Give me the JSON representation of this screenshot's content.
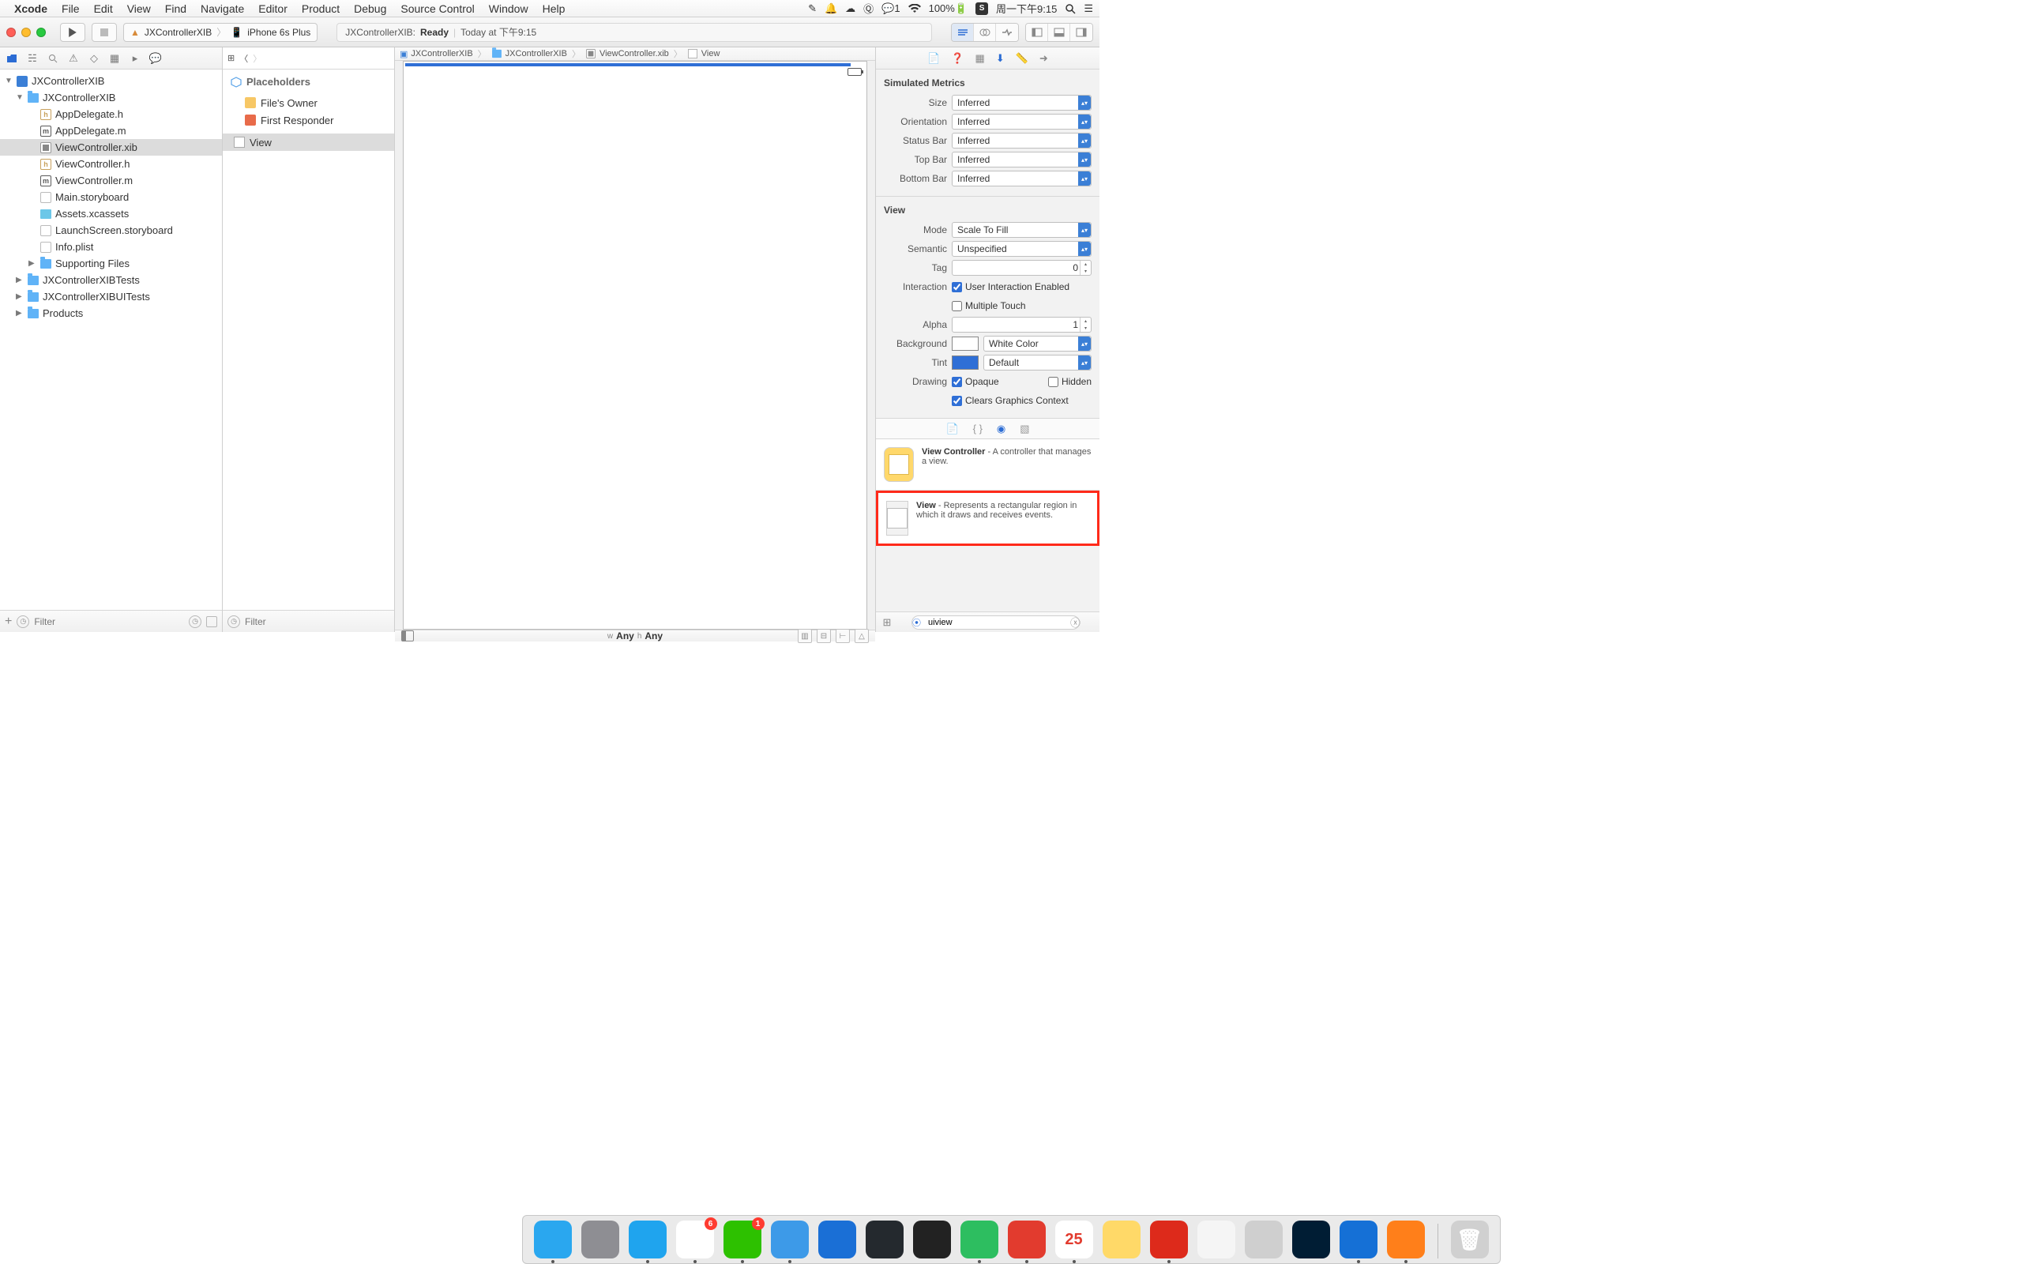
{
  "menubar": {
    "app": "Xcode",
    "items": [
      "File",
      "Edit",
      "View",
      "Find",
      "Navigate",
      "Editor",
      "Product",
      "Debug",
      "Source Control",
      "Window",
      "Help"
    ],
    "right": {
      "wechat_badge": "1",
      "battery": "100%",
      "clock": "周一下午9:15"
    }
  },
  "toolbar": {
    "scheme_target": "JXControllerXIB",
    "scheme_device": "iPhone 6s Plus",
    "activity_target": "JXControllerXIB:",
    "activity_status": "Ready",
    "activity_time": "Today at 下午9:15"
  },
  "jumpbar": {
    "project": "JXControllerXIB",
    "group": "JXControllerXIB",
    "file": "ViewController.xib",
    "item": "View"
  },
  "navigator": {
    "project": "JXControllerXIB",
    "group": "JXControllerXIB",
    "files": {
      "appdelegate_h": "AppDelegate.h",
      "appdelegate_m": "AppDelegate.m",
      "viewcontroller_xib": "ViewController.xib",
      "viewcontroller_h": "ViewController.h",
      "viewcontroller_m": "ViewController.m",
      "main_sb": "Main.storyboard",
      "assets": "Assets.xcassets",
      "launch_sb": "LaunchScreen.storyboard",
      "infoplist": "Info.plist",
      "supporting": "Supporting Files"
    },
    "tests": "JXControllerXIBTests",
    "uitests": "JXControllerXIBUITests",
    "products": "Products",
    "filter_placeholder": "Filter"
  },
  "outline": {
    "placeholders_hdr": "Placeholders",
    "files_owner": "File's Owner",
    "first_responder": "First Responder",
    "view": "View",
    "filter_placeholder": "Filter"
  },
  "sizebar": {
    "w_prefix": "w",
    "w_value": "Any",
    "h_prefix": "h",
    "h_value": "Any"
  },
  "inspector": {
    "sim_hdr": "Simulated Metrics",
    "size_lbl": "Size",
    "size_val": "Inferred",
    "orientation_lbl": "Orientation",
    "orientation_val": "Inferred",
    "statusbar_lbl": "Status Bar",
    "statusbar_val": "Inferred",
    "topbar_lbl": "Top Bar",
    "topbar_val": "Inferred",
    "bottombar_lbl": "Bottom Bar",
    "bottombar_val": "Inferred",
    "view_hdr": "View",
    "mode_lbl": "Mode",
    "mode_val": "Scale To Fill",
    "semantic_lbl": "Semantic",
    "semantic_val": "Unspecified",
    "tag_lbl": "Tag",
    "tag_val": "0",
    "interaction_lbl": "Interaction",
    "uie_lbl": "User Interaction Enabled",
    "mt_lbl": "Multiple Touch",
    "alpha_lbl": "Alpha",
    "alpha_val": "1",
    "background_lbl": "Background",
    "background_val": "White Color",
    "tint_lbl": "Tint",
    "tint_val": "Default",
    "drawing_lbl": "Drawing",
    "opaque_lbl": "Opaque",
    "hidden_lbl": "Hidden",
    "cgc_lbl": "Clears Graphics Context"
  },
  "library": {
    "vc_title": "View Controller",
    "vc_desc": " - A controller that manages a view.",
    "view_title": "View",
    "view_desc": " - Represents a rectangular region in which it draws and receives events.",
    "filter_value": "uiview"
  },
  "dock": {
    "apps": [
      {
        "name": "finder",
        "bg": "#2aa7ef",
        "running": true
      },
      {
        "name": "launchpad",
        "bg": "#8e8e93"
      },
      {
        "name": "safari",
        "bg": "#1fa4ee",
        "running": true
      },
      {
        "name": "qq",
        "bg": "#ffffff",
        "badge": "6",
        "running": true
      },
      {
        "name": "wechat",
        "bg": "#2dc100",
        "badge": "1",
        "running": true
      },
      {
        "name": "mail",
        "bg": "#3d9ae8",
        "running": true
      },
      {
        "name": "appstore",
        "bg": "#1a6fd6"
      },
      {
        "name": "github",
        "bg": "#24292e"
      },
      {
        "name": "reader",
        "bg": "#222"
      },
      {
        "name": "evernote",
        "bg": "#2dbe60",
        "running": true
      },
      {
        "name": "youdao",
        "bg": "#e23b2e",
        "running": true
      },
      {
        "name": "calendar",
        "bg": "#ffffff",
        "text": "25",
        "running": true
      },
      {
        "name": "notes",
        "bg": "#ffd968"
      },
      {
        "name": "netease-music",
        "bg": "#dd2a1b",
        "running": true
      },
      {
        "name": "duet",
        "bg": "#f5f5f5"
      },
      {
        "name": "calculator",
        "bg": "#cfcfcf"
      },
      {
        "name": "photoshop",
        "bg": "#001d34"
      },
      {
        "name": "xcode",
        "bg": "#1570d6",
        "running": true
      },
      {
        "name": "firefox",
        "bg": "#ff7f1a",
        "running": true
      }
    ],
    "trash": {
      "name": "trash",
      "bg": "#d0d0d0"
    }
  }
}
